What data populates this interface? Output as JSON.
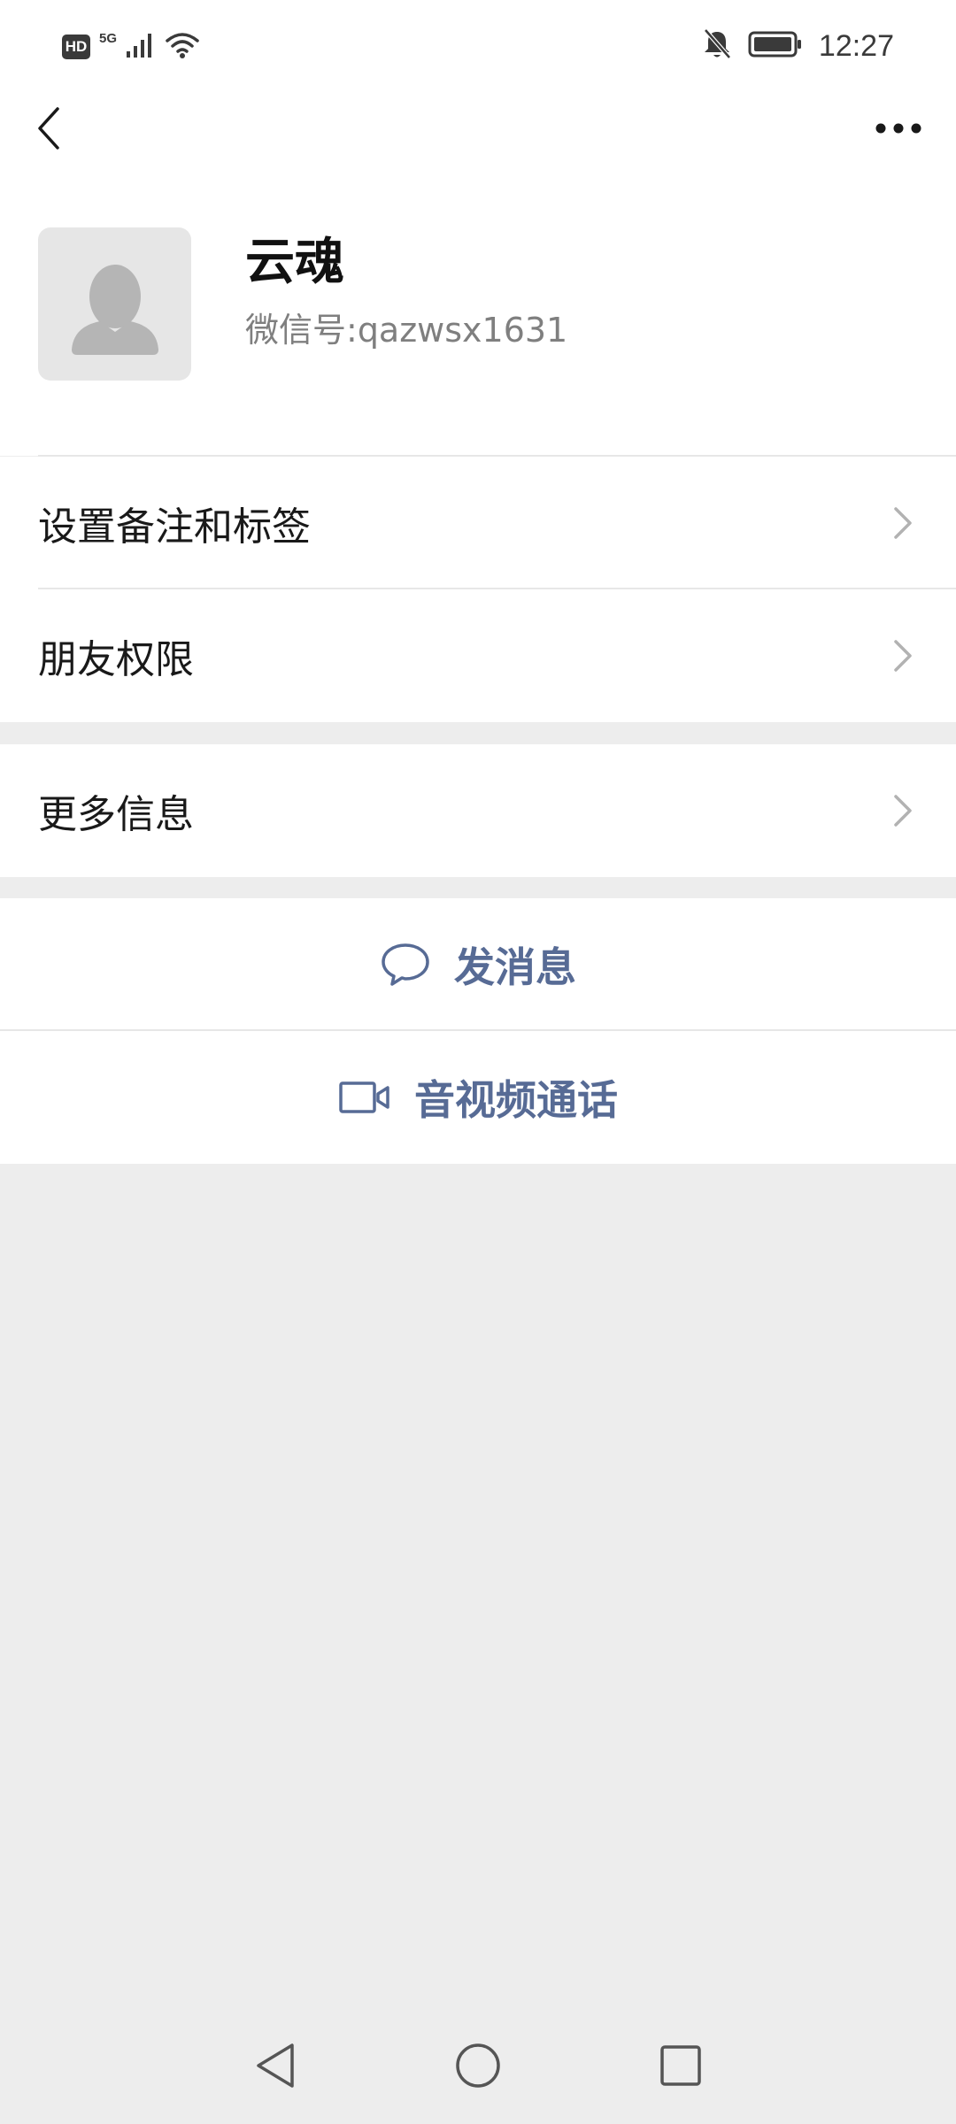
{
  "status_bar": {
    "hd": "HD",
    "network": "5G",
    "signal_icon": "signal-bars-icon",
    "wifi_icon": "wifi-icon",
    "mute_icon": "notifications-off-icon",
    "battery_icon": "battery-icon",
    "time": "12:27"
  },
  "toolbar": {
    "back_icon": "chevron-left-icon",
    "more_icon": "more-dots-icon"
  },
  "profile": {
    "name": "云魂",
    "id_label": "微信号: ",
    "id_value": "qazwsx1631",
    "avatar_icon": "default-avatar-icon"
  },
  "menu": {
    "remark_tags": "设置备注和标签",
    "friend_permissions": "朋友权限",
    "more_info": "更多信息"
  },
  "actions": {
    "send_message": "发消息",
    "video_call": "音视频通话"
  },
  "colors": {
    "link_blue": "#576b95",
    "background": "#ededed",
    "surface": "#ffffff"
  }
}
